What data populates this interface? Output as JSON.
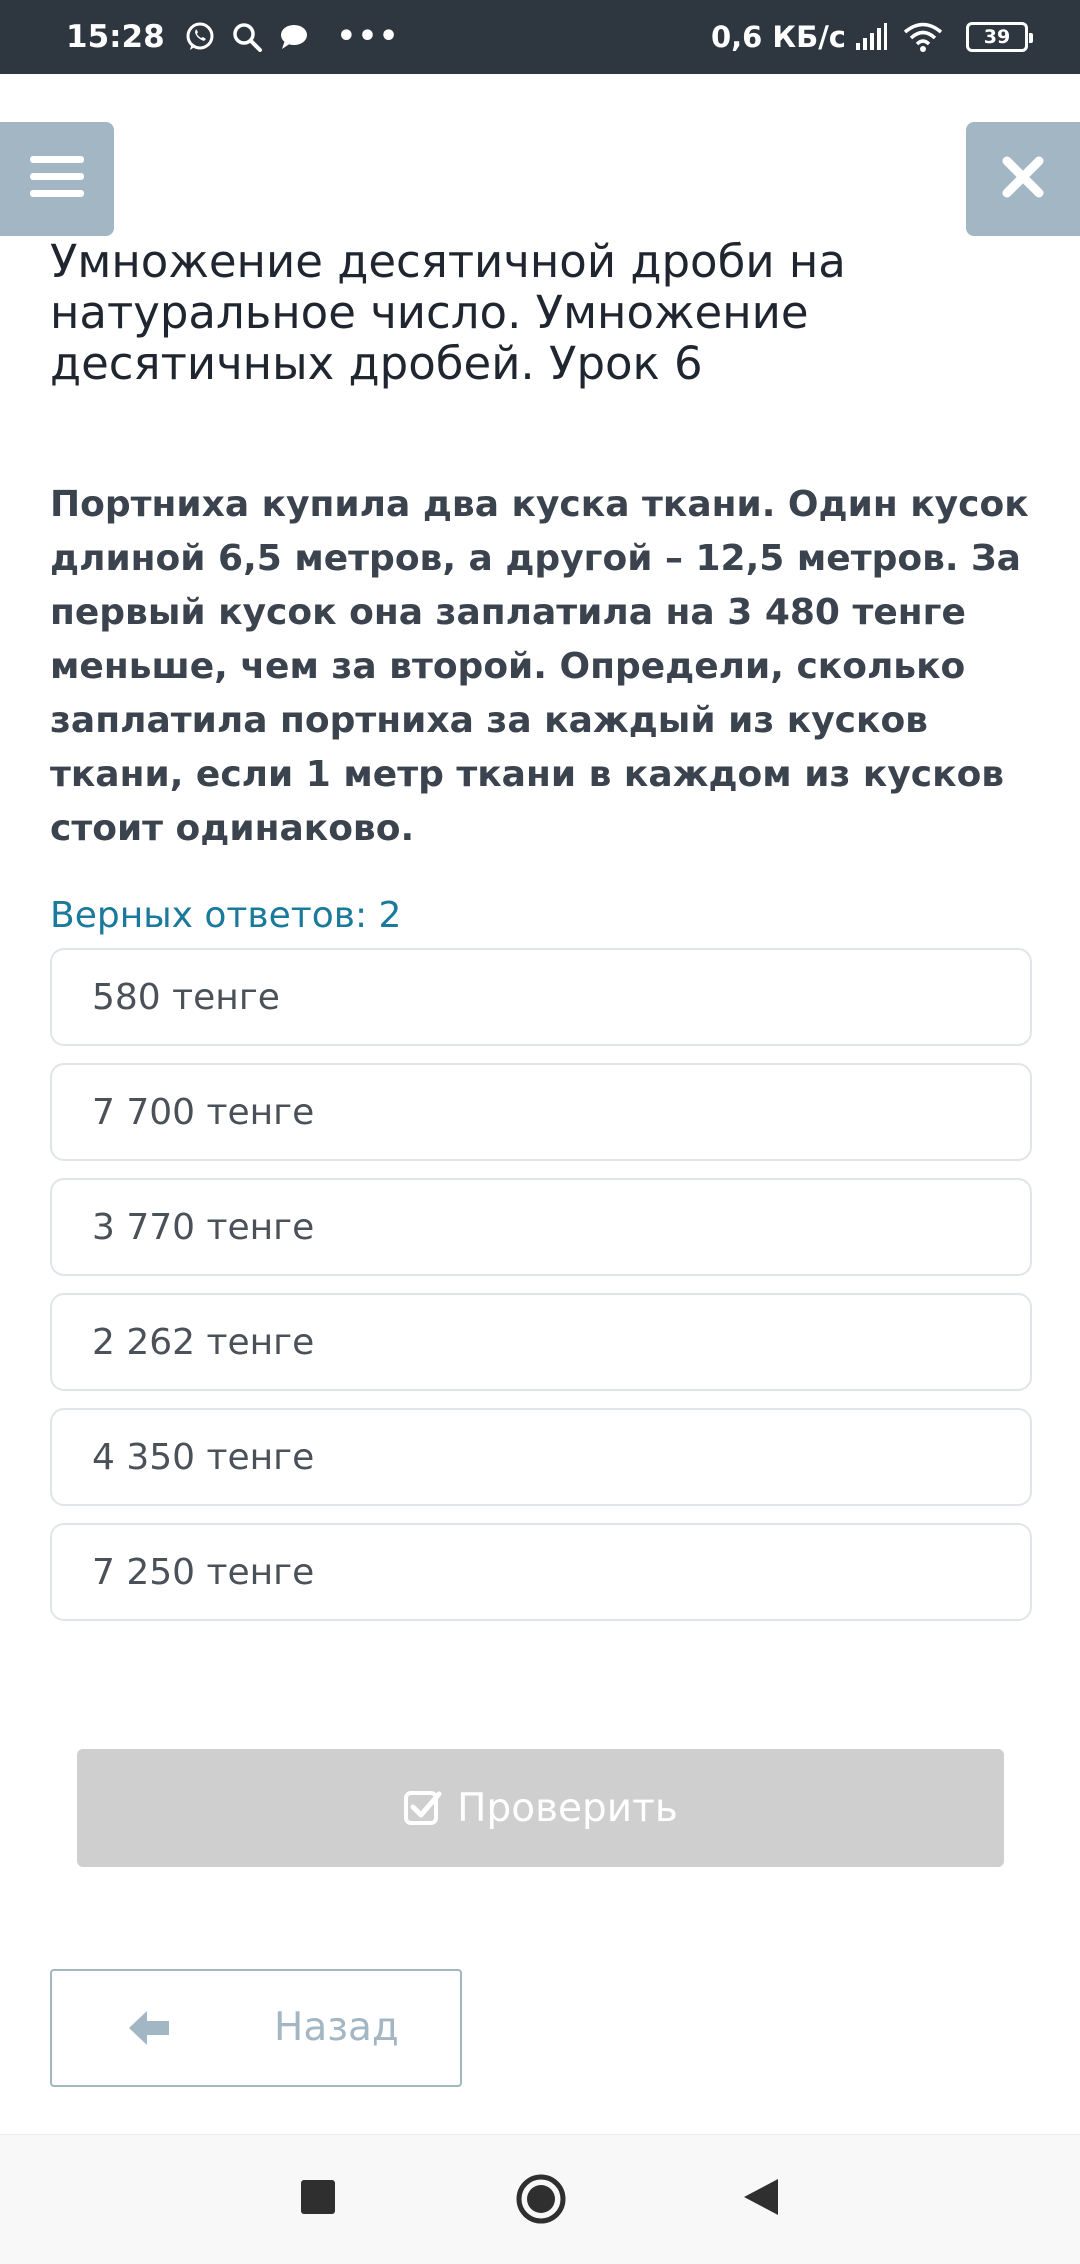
{
  "status_bar": {
    "time": "15:28",
    "speed": "0,6 КБ/с",
    "battery": "39",
    "icons": [
      "whatsapp-icon",
      "search-icon",
      "chat-icon",
      "more-dots-icon",
      "signal-icon",
      "wifi-icon",
      "battery-icon"
    ]
  },
  "header": {
    "menu_icon": "hamburger-menu-icon",
    "close_icon": "close-x-icon",
    "title": "Умножение десятичной дроби на натуральное число. Умножение десятичных дробей. Урок 6"
  },
  "question": {
    "text": "Портниха купила два куска ткани. Один кусок длиной 6,5 метров, а другой – 12,5 метров. За первый кусок она заплатила на 3 480 тенге меньше, чем за второй. Определи, сколько заплатила портниха за каждый из кусков ткани, если 1 метр ткани в каждом из кусков стоит одинаково.",
    "answers_count": "Верных ответов: 2"
  },
  "options": [
    {
      "label": "580 тенге"
    },
    {
      "label": "7 700 тенге"
    },
    {
      "label": "3 770 тенге"
    },
    {
      "label": "2 262 тенге"
    },
    {
      "label": "4 350 тенге"
    },
    {
      "label": "7 250 тенге"
    }
  ],
  "actions": {
    "check_label": "Проверить",
    "back_label": "Назад"
  },
  "colors": {
    "accent": "#1a7a9c",
    "button_slate": "#a3b6c3",
    "disabled": "#cfcfcf",
    "statusbar": "#2e3640"
  }
}
